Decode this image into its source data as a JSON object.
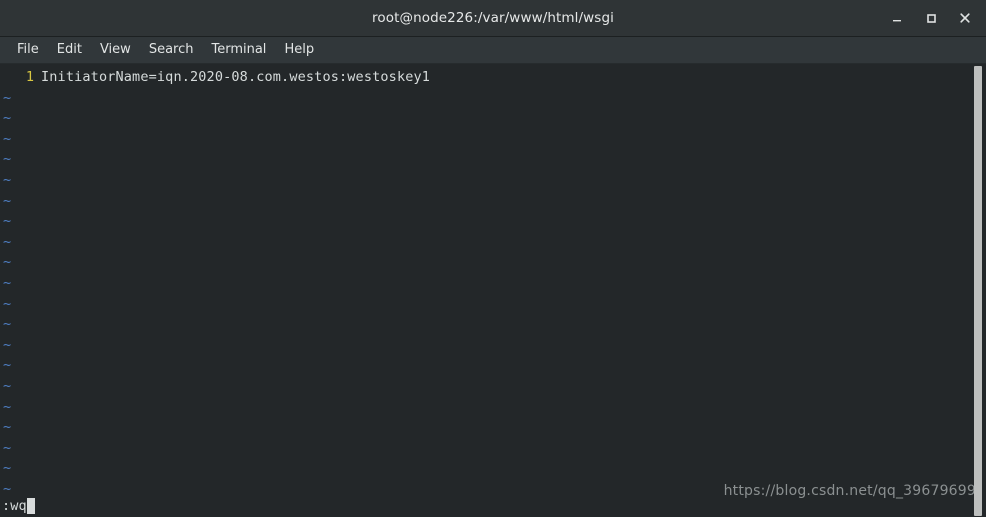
{
  "window": {
    "title": "root@node226:/var/www/html/wsgi",
    "controls": {
      "minimize_label": "Minimize",
      "maximize_label": "Maximize",
      "close_label": "Close"
    }
  },
  "menubar": {
    "items": [
      {
        "label": "File"
      },
      {
        "label": "Edit"
      },
      {
        "label": "View"
      },
      {
        "label": "Search"
      },
      {
        "label": "Terminal"
      },
      {
        "label": "Help"
      }
    ]
  },
  "editor": {
    "lines": [
      {
        "number": "1",
        "text": "InitiatorName=iqn.2020-08.com.westos:westoskey1"
      }
    ],
    "empty_marker": "~",
    "empty_marker_count": 20,
    "command_line": ":wq"
  },
  "watermark": {
    "text": "https://blog.csdn.net/qq_39679699"
  },
  "colors": {
    "titlebar_bg": "#2f3436",
    "menubar_bg": "#31373a",
    "terminal_bg": "#232729",
    "text": "#d6dbdb",
    "line_number": "#d8c642",
    "tilde": "#4f7fc4",
    "watermark": "#8b9091",
    "scrollbar": "#bdbfbe"
  }
}
